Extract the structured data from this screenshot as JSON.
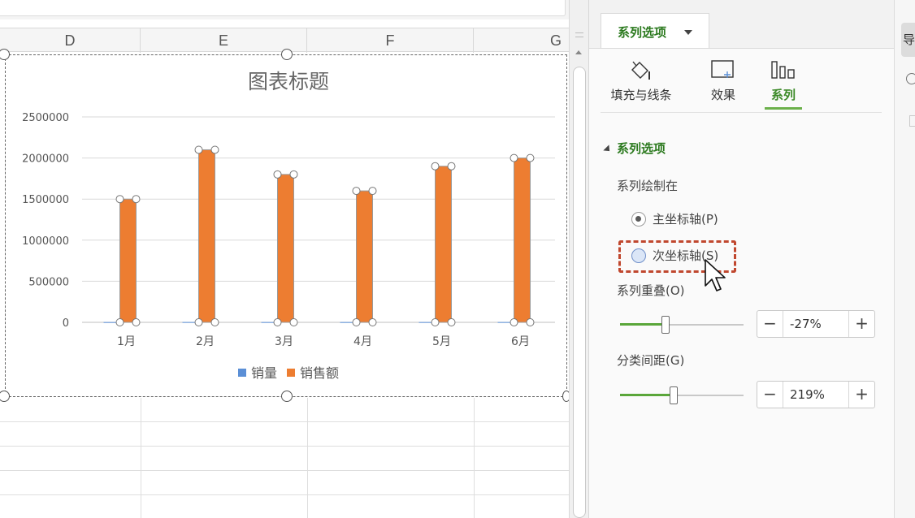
{
  "sheet": {
    "columns": [
      "D",
      "E",
      "F",
      "G"
    ]
  },
  "chart_data": {
    "type": "bar",
    "title": "图表标题",
    "categories": [
      "1月",
      "2月",
      "3月",
      "4月",
      "5月",
      "6月"
    ],
    "series": [
      {
        "name": "销量",
        "values": [
          3000,
          3500,
          3200,
          3100,
          3300,
          3400
        ],
        "color": "#5b8fd6"
      },
      {
        "name": "销售额",
        "values": [
          1500000,
          2100000,
          1800000,
          1600000,
          1900000,
          2000000
        ],
        "color": "#ed7d31"
      }
    ],
    "ylim": [
      0,
      2500000
    ],
    "yticks": [
      "2500000",
      "2000000",
      "1500000",
      "1000000",
      "500000",
      "0"
    ],
    "grid": true,
    "legend_position": "bottom"
  },
  "pane": {
    "top_tab_label": "系列选项",
    "subtabs": [
      {
        "label": "填充与线条",
        "icon": "fill-bucket-icon"
      },
      {
        "label": "效果",
        "icon": "effects-icon"
      },
      {
        "label": "系列",
        "icon": "series-bars-icon"
      }
    ],
    "section_title": "系列选项",
    "plot_on_label": "系列绘制在",
    "primary_axis_label": "主坐标轴(P)",
    "secondary_axis_label": "次坐标轴(S)",
    "overlap_label": "系列重叠(O)",
    "overlap_value": "-27%",
    "overlap_fraction": 0.36,
    "gap_label": "分类间距(G)",
    "gap_value": "219%",
    "gap_fraction": 0.43,
    "minus_label": "−",
    "plus_label": "+"
  },
  "colors": {
    "accent_green": "#2c7a1f",
    "highlight_red": "#c0472e",
    "bar_orange": "#ed7d31",
    "bar_blue": "#5b8fd6"
  },
  "far_strip": {
    "button_char": "导"
  }
}
